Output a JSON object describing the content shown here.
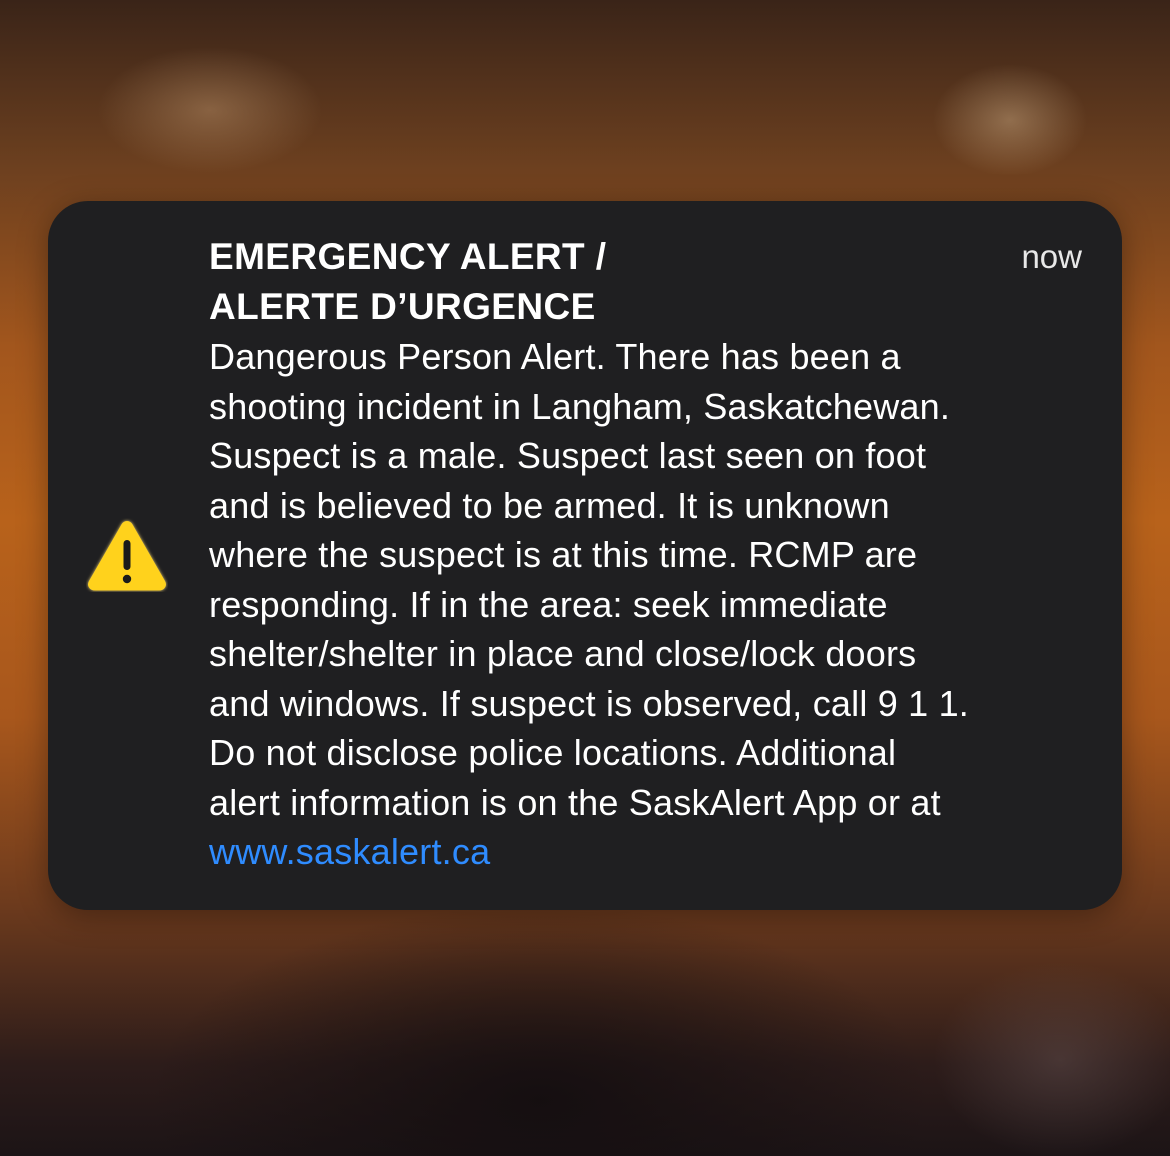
{
  "alert": {
    "title_line1": "EMERGENCY ALERT /",
    "title_line2": "ALERTE D’URGENCE",
    "time": "now",
    "body_lines": [
      "Dangerous Person Alert. There has been a",
      "shooting incident in Langham, Saskatchewan.",
      "Suspect is a male. Suspect last seen on foot",
      "and is believed to be armed. It is unknown",
      "where the suspect is at this time. RCMP are",
      "responding. If in the area: seek immediate",
      "shelter/shelter in place and close/lock doors",
      "and windows. If suspect is observed, call 9 1 1.",
      "Do not disclose police locations. Additional",
      "alert information is on the SaskAlert App or at"
    ],
    "link": "www.saskalert.ca",
    "icon": "warning-triangle-icon",
    "colors": {
      "banner_bg": "#1f1f21",
      "icon_fill": "#ffd21f",
      "link": "#2f8cff",
      "text": "#ffffff"
    }
  }
}
